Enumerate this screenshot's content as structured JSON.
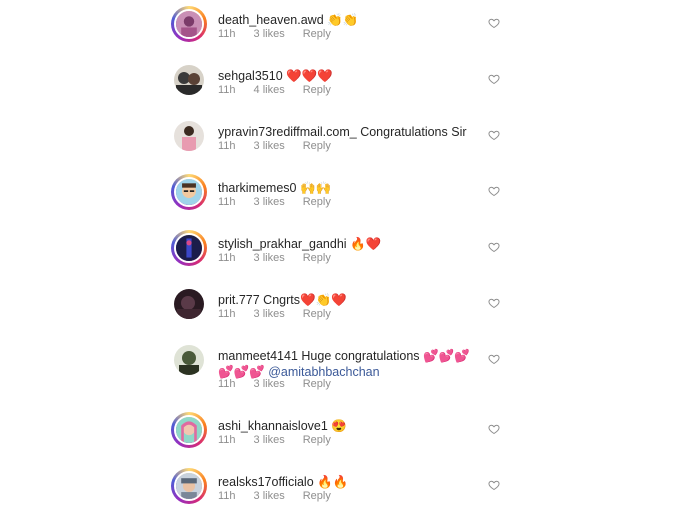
{
  "comments": [
    {
      "username": "death_heaven.awd",
      "text": " 👏👏",
      "mention": "",
      "time": "11h",
      "likes": "3 likes",
      "reply": "Reply",
      "avatar_color": "#b86b9b"
    },
    {
      "username": "sehgal3510",
      "text": " ❤️❤️❤️",
      "mention": "",
      "time": "11h",
      "likes": "4 likes",
      "reply": "Reply",
      "avatar_color": "#3a3a3a"
    },
    {
      "username": "ypravin73rediffmail.com_",
      "text": " Congratulations Sir",
      "mention": "",
      "time": "11h",
      "likes": "3 likes",
      "reply": "Reply",
      "avatar_color": "#d98aa0"
    },
    {
      "username": "tharkimemes0",
      "text": " 🙌🙌",
      "mention": "",
      "time": "11h",
      "likes": "3 likes",
      "reply": "Reply",
      "avatar_color": "#6fb7d8"
    },
    {
      "username": "stylish_prakhar_gandhi",
      "text": " 🔥❤️",
      "mention": "",
      "time": "11h",
      "likes": "3 likes",
      "reply": "Reply",
      "avatar_color": "#2c2e7a"
    },
    {
      "username": "prit.777",
      "text": " Cngrts❤️👏❤️",
      "mention": "",
      "time": "11h",
      "likes": "3 likes",
      "reply": "Reply",
      "avatar_color": "#3b2530"
    },
    {
      "username": "manmeet4141",
      "text": " Huge congratulations 💕💕💕💕💕💕",
      "mention": "@amitabhbachchan",
      "time": "11h",
      "likes": "3 likes",
      "reply": "Reply",
      "avatar_color": "#4a5a3a"
    },
    {
      "username": "ashi_khannaislove1",
      "text": " 😍",
      "mention": "",
      "time": "11h",
      "likes": "3 likes",
      "reply": "Reply",
      "avatar_color": "#7fd3c0"
    },
    {
      "username": "realsks17officialo",
      "text": " 🔥🔥",
      "mention": "",
      "time": "11h",
      "likes": "3 likes",
      "reply": "Reply",
      "avatar_color": "#8fa0b5"
    }
  ]
}
